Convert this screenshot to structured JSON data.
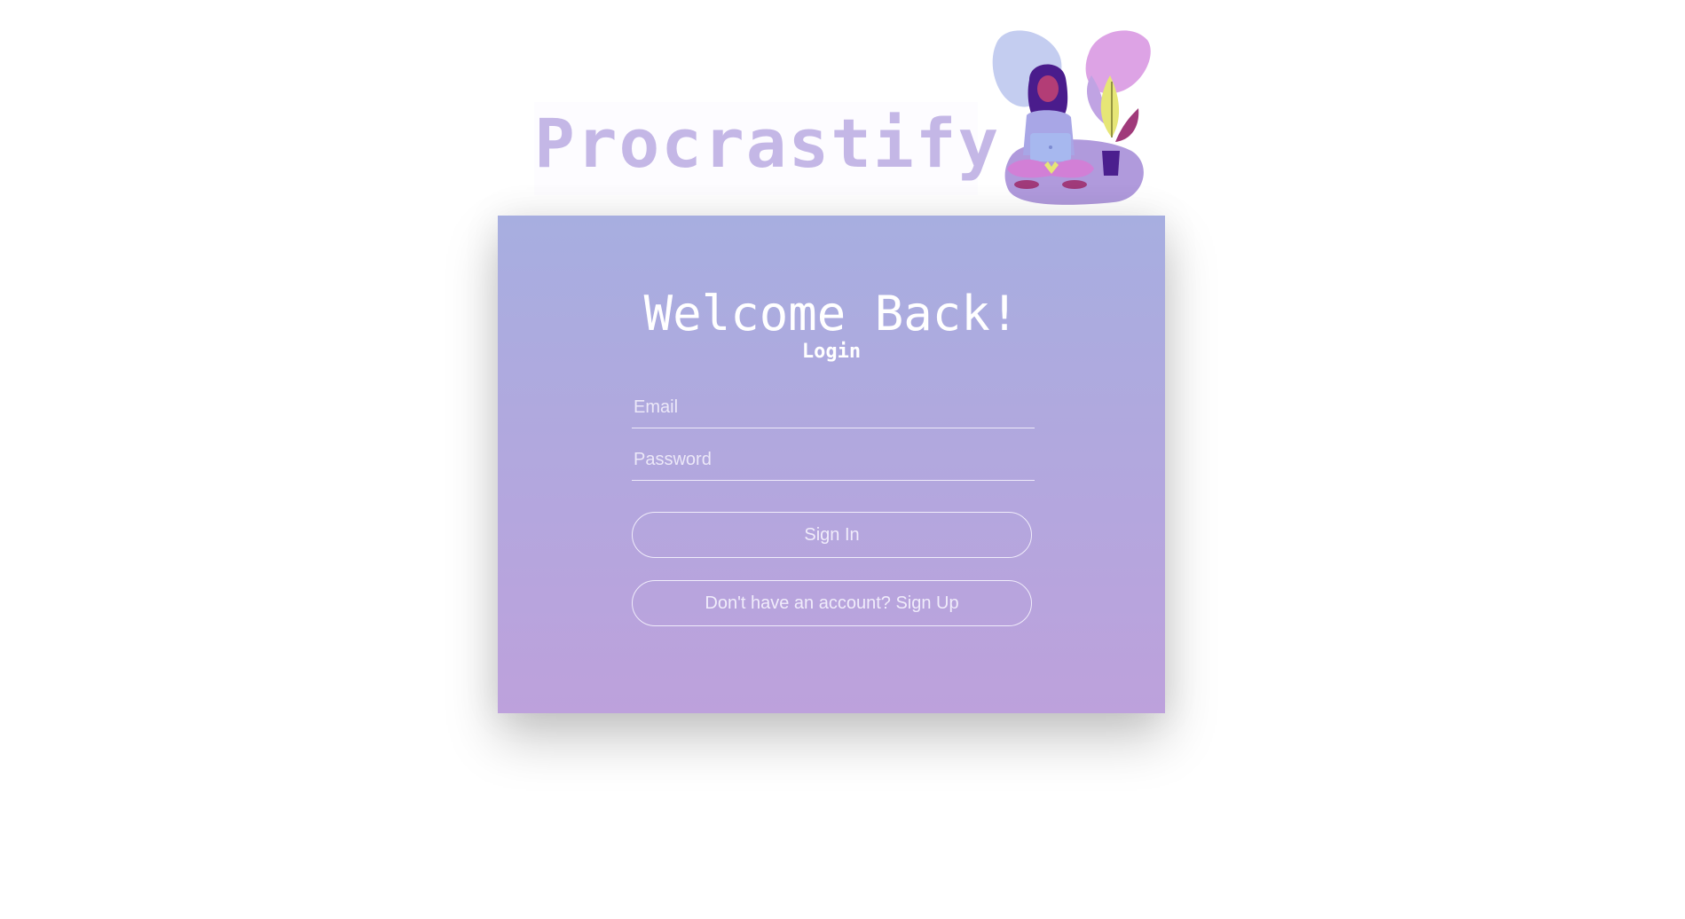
{
  "brand": {
    "name": "Procrastify"
  },
  "login": {
    "heading": "Welcome Back!",
    "subheading": "Login",
    "email_placeholder": "Email",
    "email_value": "",
    "password_placeholder": "Password",
    "password_value": "",
    "signin_label": "Sign In",
    "signup_label": "Don't have an account? Sign Up"
  },
  "icons": {
    "hero": "person-meditating-with-laptop-illustration"
  },
  "colors": {
    "brand_text": "#c4b7e6",
    "card_gradient_top": "#a7aee0",
    "card_gradient_bottom": "#bda1dc",
    "card_text": "#ffffff"
  }
}
